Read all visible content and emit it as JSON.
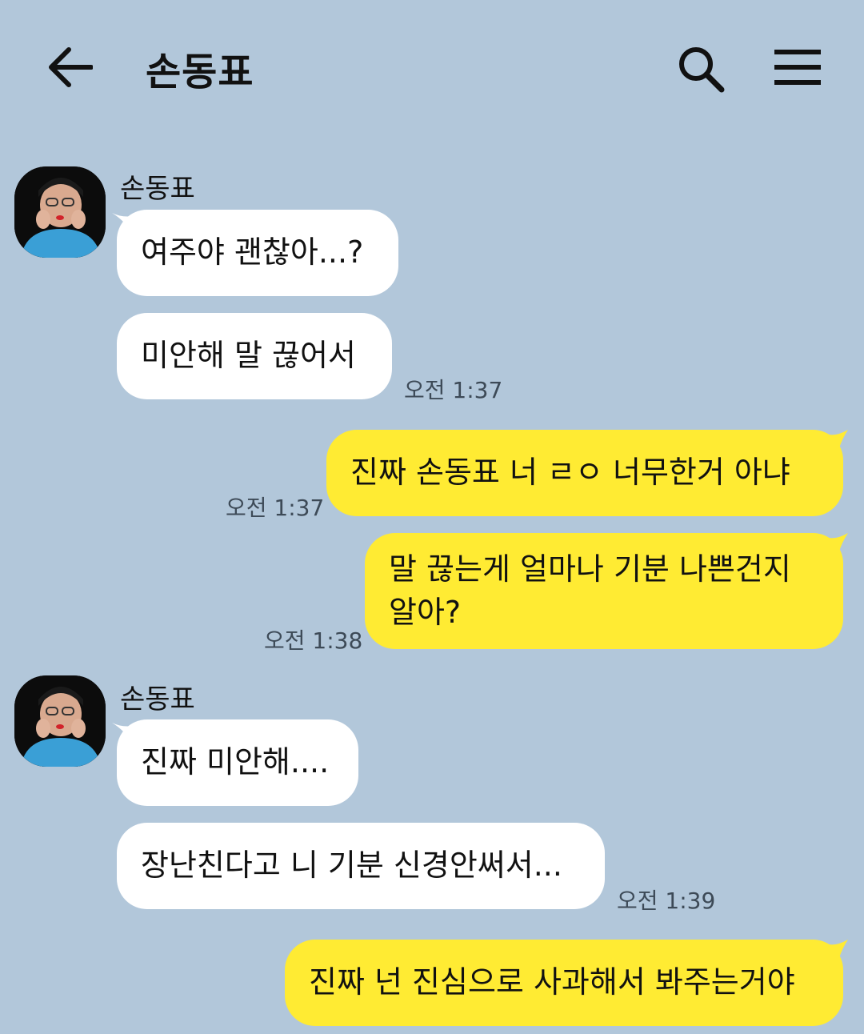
{
  "header": {
    "title": "손동표"
  },
  "messages": {
    "group1": {
      "sender": "손동표",
      "m1": "여주야 괜찮아...?",
      "m2": "미안해 말 끊어서",
      "time": "오전 1:37"
    },
    "out1": {
      "text": "진짜 손동표 너 ㄹㅇ 너무한거 아냐",
      "time": "오전 1:37"
    },
    "out2": {
      "line1": "말 끊는게 얼마나 기분 나쁜건지",
      "line2": "알아?",
      "time": "오전 1:38"
    },
    "group2": {
      "sender": "손동표",
      "m1": "진짜 미안해....",
      "m2": "장난친다고 니 기분 신경안써서...",
      "time": "오전 1:39"
    },
    "out3": {
      "text": "진짜 넌 진심으로 사과해서 봐주는거야"
    }
  },
  "colors": {
    "background": "#b2c7da",
    "outgoing_bubble": "#ffeb33",
    "incoming_bubble": "#ffffff"
  },
  "icons": [
    "arrow-left-icon",
    "search-icon",
    "hamburger-menu-icon"
  ]
}
